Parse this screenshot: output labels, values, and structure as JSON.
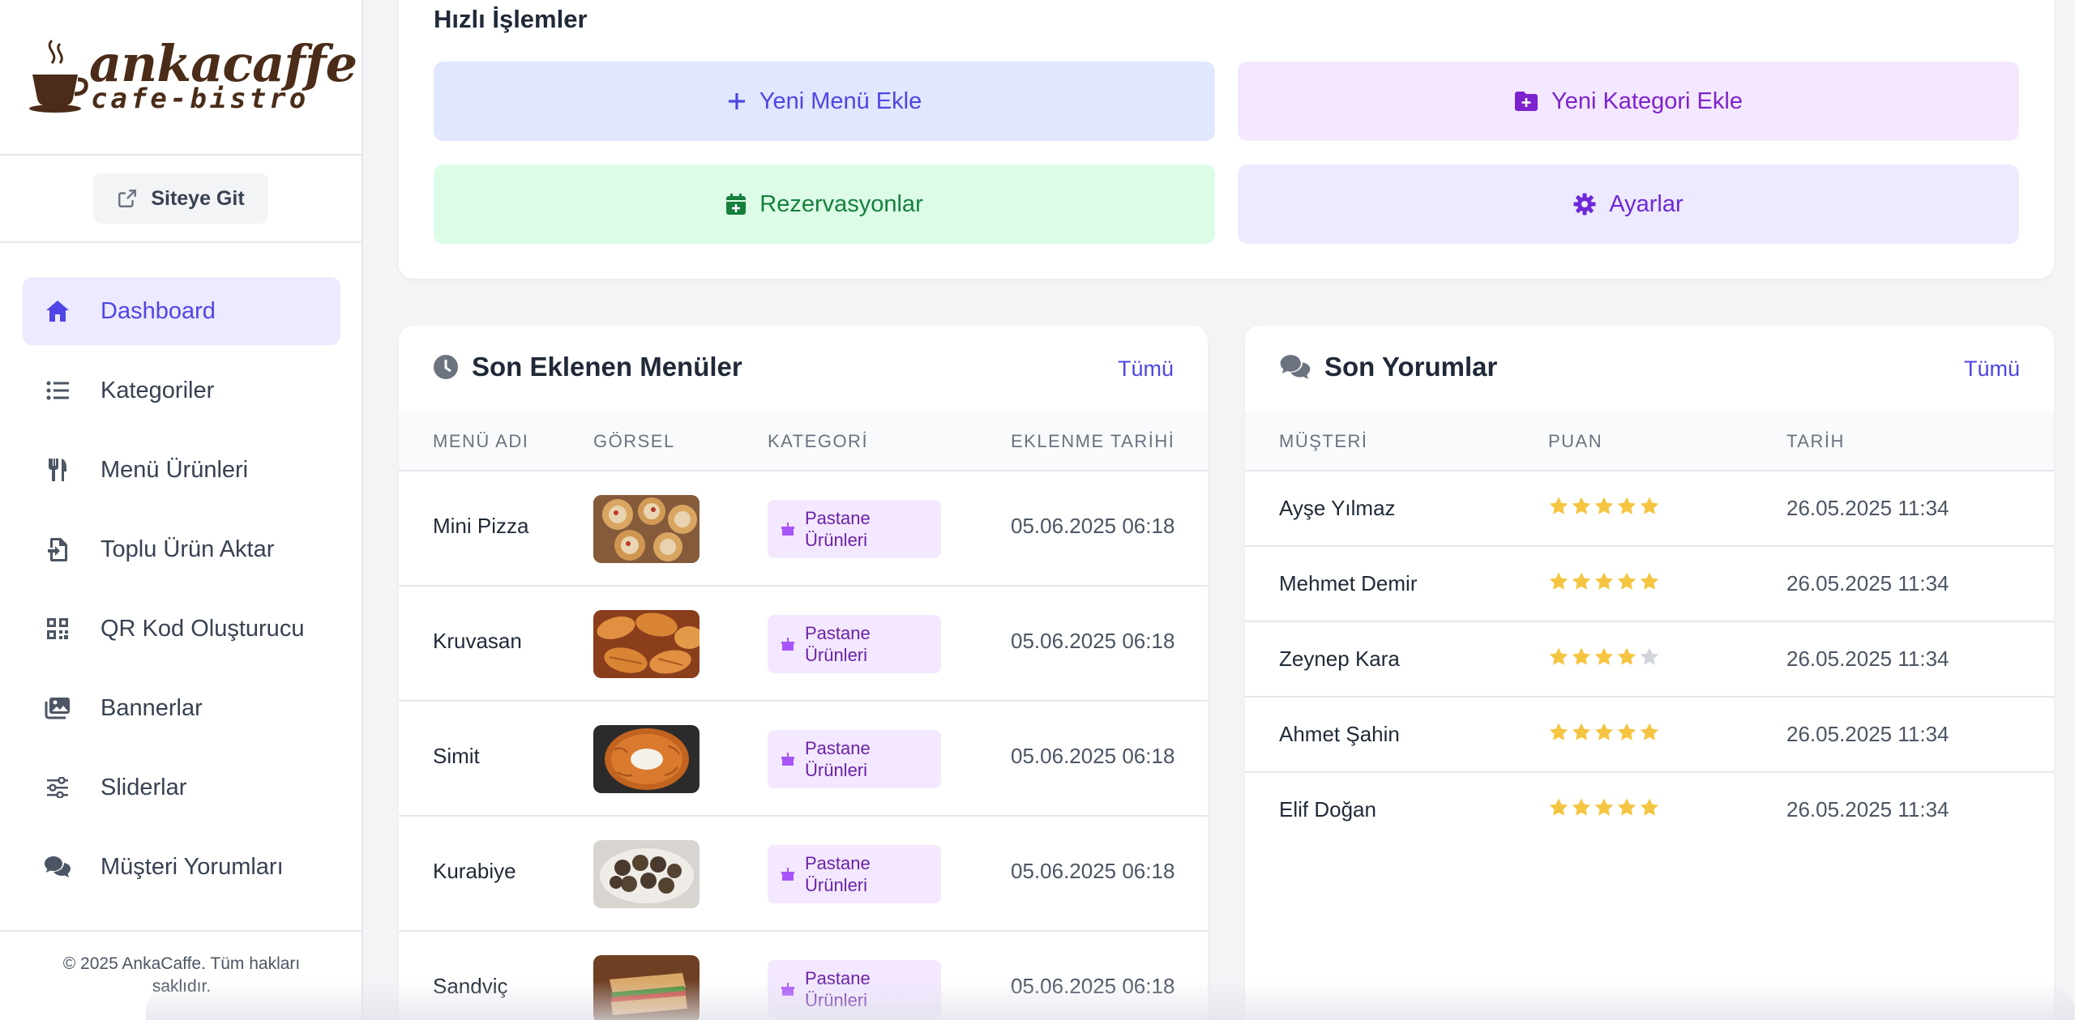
{
  "brand": {
    "name": "ankacaffe",
    "tagline": "cafe-bistro",
    "brown": "#4a2c18"
  },
  "sidebar": {
    "site_button": "Siteye Git",
    "items": [
      {
        "label": "Dashboard",
        "icon": "home-icon",
        "active": true
      },
      {
        "label": "Kategoriler",
        "icon": "list-icon"
      },
      {
        "label": "Menü Ürünleri",
        "icon": "utensils-icon"
      },
      {
        "label": "Toplu Ürün Aktar",
        "icon": "file-import-icon"
      },
      {
        "label": "QR Kod Oluşturucu",
        "icon": "qr-code-icon"
      },
      {
        "label": "Bannerlar",
        "icon": "images-icon"
      },
      {
        "label": "Sliderlar",
        "icon": "sliders-icon"
      },
      {
        "label": "Müşteri Yorumları",
        "icon": "comments-icon"
      }
    ],
    "footer": "© 2025 AnkaCaffe. Tüm hakları saklıdır."
  },
  "quick_actions": {
    "title": "Hızlı İşlemler",
    "buttons": [
      {
        "label": "Yeni Menü Ekle",
        "icon": "plus-icon"
      },
      {
        "label": "Yeni Kategori Ekle",
        "icon": "folder-plus-icon"
      },
      {
        "label": "Rezervasyonlar",
        "icon": "calendar-plus-icon"
      },
      {
        "label": "Ayarlar",
        "icon": "gear-icon"
      }
    ]
  },
  "recent_menus": {
    "title": "Son Eklenen Menüler",
    "link": "Tümü",
    "headers": [
      "MENÜ ADI",
      "GÖRSEL",
      "KATEGORİ",
      "EKLENME TARİHİ"
    ],
    "rows": [
      {
        "name": "Mini Pizza",
        "category_line1": "Pastane",
        "category_line2": "Ürünleri",
        "date": "05.06.2025 06:18"
      },
      {
        "name": "Kruvasan",
        "category_line1": "Pastane",
        "category_line2": "Ürünleri",
        "date": "05.06.2025 06:18"
      },
      {
        "name": "Simit",
        "category_line1": "Pastane",
        "category_line2": "Ürünleri",
        "date": "05.06.2025 06:18"
      },
      {
        "name": "Kurabiye",
        "category_line1": "Pastane",
        "category_line2": "Ürünleri",
        "date": "05.06.2025 06:18"
      },
      {
        "name": "Sandviç",
        "category_line1": "Pastane",
        "category_line2": "Ürünleri",
        "date": "05.06.2025 06:18"
      }
    ]
  },
  "recent_reviews": {
    "title": "Son Yorumlar",
    "link": "Tümü",
    "headers": [
      "MÜŞTERİ",
      "PUAN",
      "TARİH"
    ],
    "rows": [
      {
        "customer": "Ayşe Yılmaz",
        "rating": 5,
        "date": "26.05.2025 11:34"
      },
      {
        "customer": "Mehmet Demir",
        "rating": 5,
        "date": "26.05.2025 11:34"
      },
      {
        "customer": "Zeynep Kara",
        "rating": 4,
        "date": "26.05.2025 11:34"
      },
      {
        "customer": "Ahmet Şahin",
        "rating": 5,
        "date": "26.05.2025 11:34"
      },
      {
        "customer": "Elif Doğan",
        "rating": 5,
        "date": "26.05.2025 11:34"
      }
    ]
  },
  "colors": {
    "accent": "#4f46e5",
    "star": "#f5c542",
    "star_empty": "#d1d5db"
  }
}
